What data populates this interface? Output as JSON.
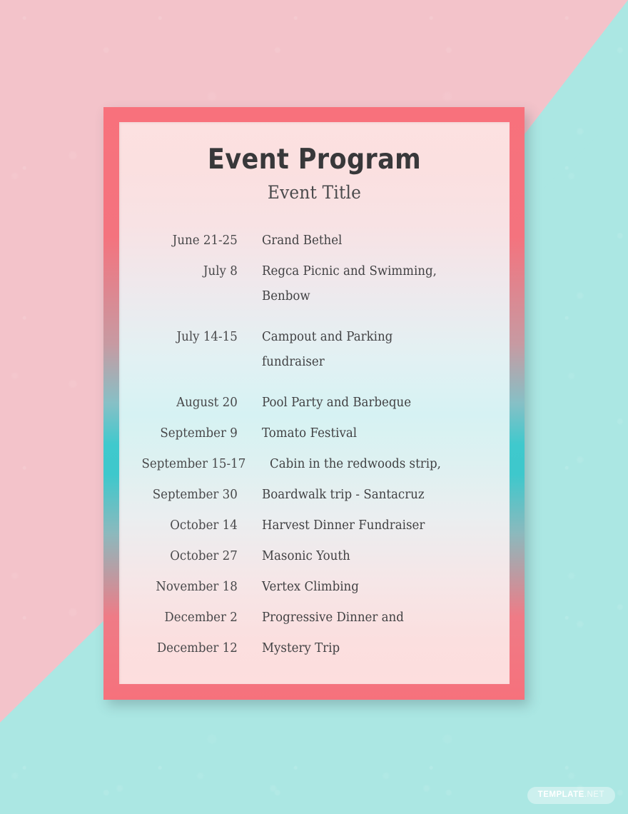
{
  "document": {
    "program_title": "Event Program",
    "event_title": "Event Title"
  },
  "schedule": {
    "rows": [
      {
        "date": "June 21-25",
        "event": "Grand Bethel",
        "lines": [
          "Grand Bethel"
        ]
      },
      {
        "date": "July 8",
        "event": "Regca Picnic and Swimming, Benbow",
        "lines": [
          "Regca Picnic and Swimming,",
          "Benbow"
        ]
      },
      {
        "date": "July 14-15",
        "event": "Campout and Parking fundraiser",
        "lines": [
          "Campout and Parking",
          "fundraiser"
        ]
      },
      {
        "date": "August 20",
        "event": "Pool Party and Barbeque",
        "lines": [
          "Pool Party and Barbeque"
        ]
      },
      {
        "date": "September 9",
        "event": "Tomato Festival",
        "lines": [
          "Tomato Festival"
        ]
      },
      {
        "date": "September 15-17",
        "event": "Cabin in the redwoods strip,",
        "lines": [
          "Cabin in the redwoods strip,"
        ]
      },
      {
        "date": "September 30",
        "event": "Boardwalk trip - Santacruz",
        "lines": [
          "Boardwalk trip - Santacruz"
        ]
      },
      {
        "date": "October 14",
        "event": "Harvest Dinner Fundraiser",
        "lines": [
          "Harvest Dinner Fundraiser"
        ]
      },
      {
        "date": "October 27",
        "event": "Masonic Youth",
        "lines": [
          "Masonic Youth"
        ]
      },
      {
        "date": "November 18",
        "event": "Vertex Climbing",
        "lines": [
          "Vertex Climbing"
        ]
      },
      {
        "date": "December 2",
        "event": "Progressive Dinner and",
        "lines": [
          "Progressive Dinner and"
        ]
      },
      {
        "date": "December 12",
        "event": "Mystery Trip",
        "lines": [
          "Mystery Trip"
        ]
      }
    ]
  },
  "watermark": {
    "strong": "TEMPLATE",
    "light": ".NET"
  },
  "colors": {
    "background_pink": "#f3c3ca",
    "background_teal": "#abe7e3",
    "frame_coral": "#f6717c",
    "frame_teal": "#3ec8cc",
    "page_pink": "#fce1e1",
    "page_cyan": "#d6f2f3",
    "text_dark": "#38383a",
    "text_body": "#444446"
  }
}
